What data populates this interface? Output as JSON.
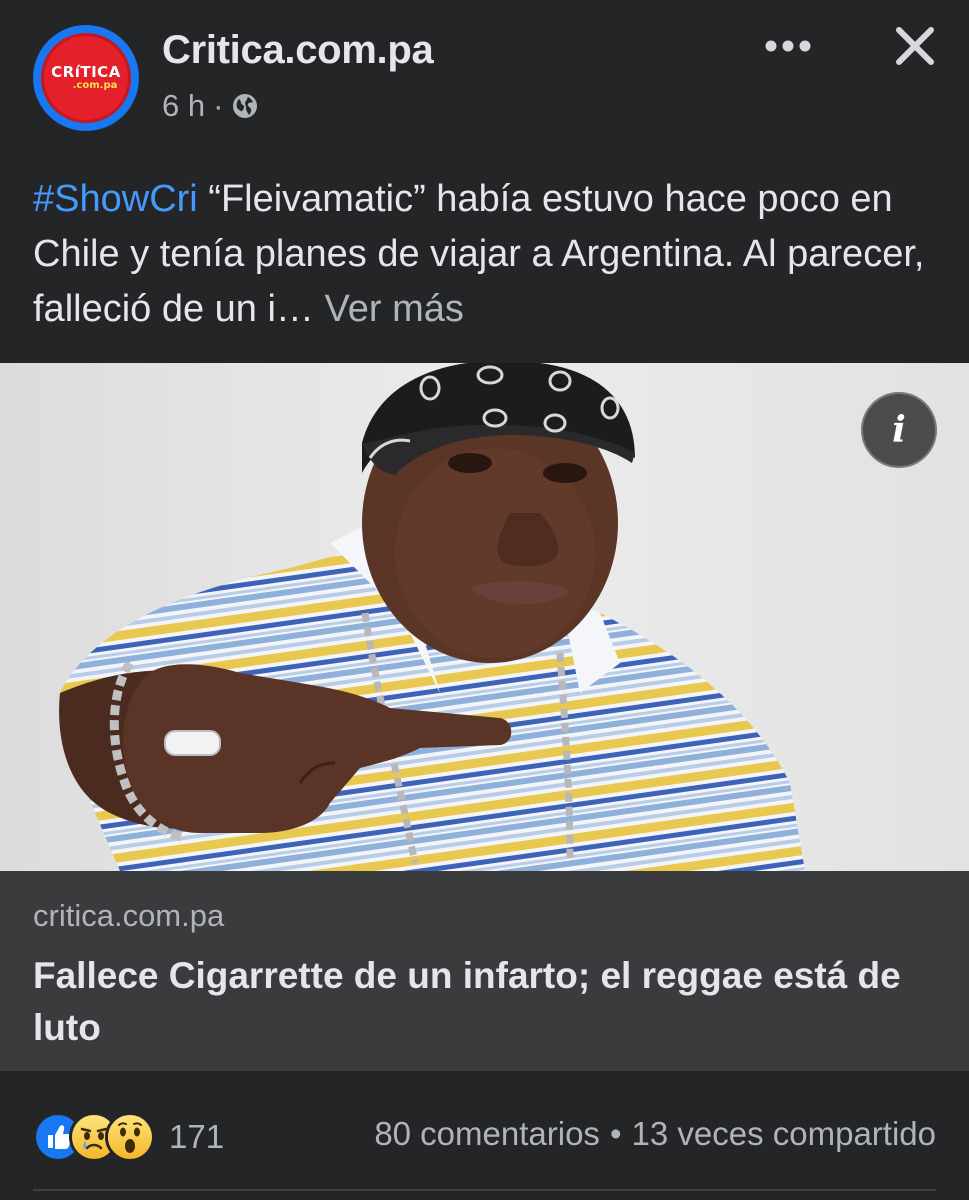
{
  "post": {
    "page_name": "Critica.com.pa",
    "time": "6 h",
    "separator": "·",
    "audience_icon": "globe-icon",
    "avatar": {
      "logo_text": "CRíTICA",
      "logo_sub": ".com.pa",
      "colors": {
        "ring": "#1877f2",
        "fill": "#e4202a"
      }
    },
    "text": {
      "hashtag": "#ShowCri",
      "body": " “Fleivamatic” había estuvo hace poco en Chile y tenía planes de viajar a Argentina. Al parecer, falleció de un i… ",
      "see_more": "Ver más"
    },
    "photo": {
      "info_label": "i"
    }
  },
  "link_card": {
    "domain": "critica.com.pa",
    "title": "Fallece Cigarrette de un infarto; el reggae está de luto"
  },
  "footer": {
    "reaction_icons": [
      "like-icon",
      "sad-icon",
      "wow-icon"
    ],
    "reaction_count": "171",
    "comments": "80 comentarios",
    "dot": "•",
    "shares": "13 veces compartido"
  },
  "colors": {
    "background": "#242526",
    "hashtag": "#4599ff",
    "muted": "#b0b3b8",
    "card": "#3a3b3c"
  }
}
